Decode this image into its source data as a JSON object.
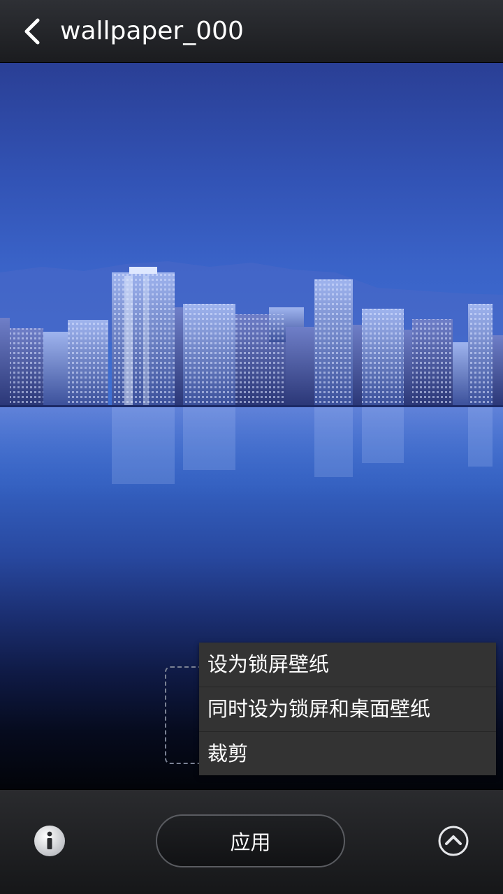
{
  "header": {
    "title": "wallpaper_000",
    "back_icon": "chevron-left-icon"
  },
  "menu": {
    "items": [
      {
        "label": "设为锁屏壁纸"
      },
      {
        "label": "同时设为锁屏和桌面壁纸"
      },
      {
        "label": "裁剪"
      }
    ]
  },
  "footer": {
    "apply_label": "应用",
    "info_icon": "info-icon",
    "expand_icon": "chevron-up-circle-icon"
  },
  "colors": {
    "topbar": "#1f2023",
    "menu_bg": "#333333",
    "sky_top": "#2a3f95",
    "sky_mid": "#3e6fd2",
    "bottom": "#020409"
  }
}
